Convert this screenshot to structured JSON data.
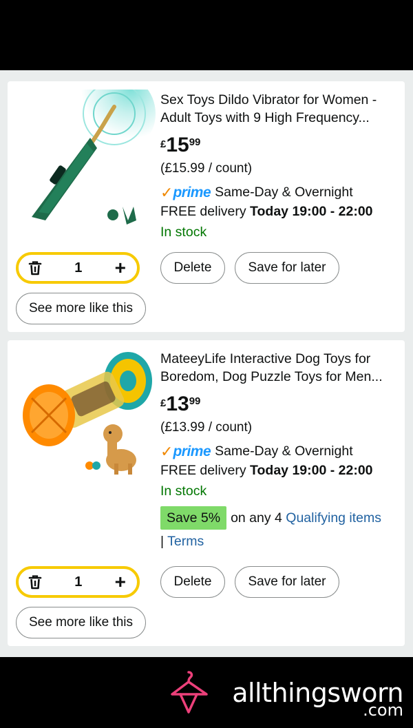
{
  "items": [
    {
      "title": "Sex Toys Dildo Vibrator for Women - Adult Toys with 9 High Frequency...",
      "currency": "£",
      "price_whole": "15",
      "price_fraction": "99",
      "unit_price": "(£15.99 / count)",
      "prime_check": "✓",
      "prime_word": "prime",
      "prime_text": "Same-Day & Overnight",
      "delivery_prefix": "FREE delivery ",
      "delivery_time": "Today 19:00 - 22:00",
      "stock": "In stock",
      "quantity": "1",
      "delete_label": "Delete",
      "save_label": "Save for later",
      "see_more_label": "See more like this",
      "checked": true
    },
    {
      "title": "MateeyLife Interactive Dog Toys for Boredom, Dog Puzzle Toys for Men...",
      "currency": "£",
      "price_whole": "13",
      "price_fraction": "99",
      "unit_price": "(£13.99 / count)",
      "prime_check": "✓",
      "prime_word": "prime",
      "prime_text": "Same-Day & Overnight",
      "delivery_prefix": "FREE delivery ",
      "delivery_time": "Today 19:00 - 22:00",
      "stock": "In stock",
      "promo_badge": "Save 5%",
      "promo_text": "on any 4 ",
      "promo_link": "Qualifying items",
      "terms_sep": "| ",
      "terms_link": "Terms",
      "quantity": "1",
      "delete_label": "Delete",
      "save_label": "Save for later",
      "see_more_label": "See more like this",
      "checked": true
    }
  ],
  "watermark": {
    "name": "allthingsworn",
    "tld": ".com"
  },
  "colors": {
    "checkbox": "#2f6aa8",
    "qty_border": "#F7CA00",
    "prime_blue": "#1A98FF",
    "prime_orange": "#F08804",
    "stock_green": "#007600",
    "save_badge": "#7fda69",
    "link": "#2162a1",
    "brand_pink": "#ec407a"
  }
}
